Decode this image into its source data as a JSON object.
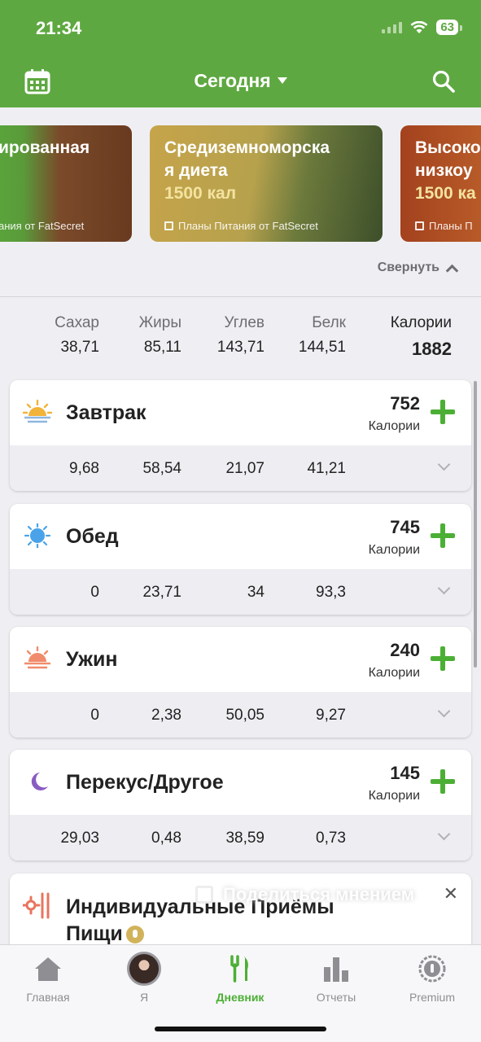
{
  "status": {
    "time": "21:34",
    "battery": "63"
  },
  "nav": {
    "title": "Сегодня",
    "calendar_icon": "calendar-icon",
    "search_icon": "search-icon"
  },
  "banners": [
    {
      "title": "ированная",
      "calories": "",
      "source": "ания от FatSecret"
    },
    {
      "title_line1": "Средиземноморска",
      "title_line2": "я диета",
      "calories": "1500 кал",
      "source": "Планы Питания от FatSecret"
    },
    {
      "title_line1": "Высоко",
      "title_line2": "низкоу",
      "calories": "1500 ка",
      "source": "Планы П"
    }
  ],
  "collapse_label": "Свернуть",
  "totals": {
    "labels": {
      "sugar": "Сахар",
      "fat": "Жиры",
      "carbs": "Углев",
      "protein": "Белк",
      "calories": "Калории"
    },
    "values": {
      "sugar": "38,71",
      "fat": "85,11",
      "carbs": "143,71",
      "protein": "144,51",
      "calories": "1882"
    }
  },
  "meals": [
    {
      "name": "Завтрак",
      "calories": "752",
      "calories_label": "Калории",
      "icon": "sunrise-icon",
      "sugar": "9,68",
      "fat": "58,54",
      "carbs": "21,07",
      "protein": "41,21"
    },
    {
      "name": "Обед",
      "calories": "745",
      "calories_label": "Калории",
      "icon": "sun-icon",
      "sugar": "0",
      "fat": "23,71",
      "carbs": "34",
      "protein": "93,3"
    },
    {
      "name": "Ужин",
      "calories": "240",
      "calories_label": "Калории",
      "icon": "sunset-icon",
      "sugar": "0",
      "fat": "2,38",
      "carbs": "50,05",
      "protein": "9,27"
    },
    {
      "name": "Перекус/Другое",
      "calories": "145",
      "calories_label": "Калории",
      "icon": "moon-icon",
      "sugar": "29,03",
      "fat": "0,48",
      "carbs": "38,59",
      "protein": "0,73"
    }
  ],
  "custom_meals": {
    "line1": "Индивидуальные Приёмы",
    "line2": "Пищи"
  },
  "feedback": {
    "label": "Поделиться мнением"
  },
  "tabs": [
    {
      "label": "Главная",
      "icon": "home-icon"
    },
    {
      "label": "Я",
      "icon": "avatar"
    },
    {
      "label": "Дневник",
      "icon": "fork-knife-icon",
      "active": true
    },
    {
      "label": "Отчеты",
      "icon": "bar-chart-icon"
    },
    {
      "label": "Premium",
      "icon": "premium-badge-icon"
    }
  ],
  "colors": {
    "brand_green": "#5ea841",
    "accent_green": "#4caf35"
  }
}
